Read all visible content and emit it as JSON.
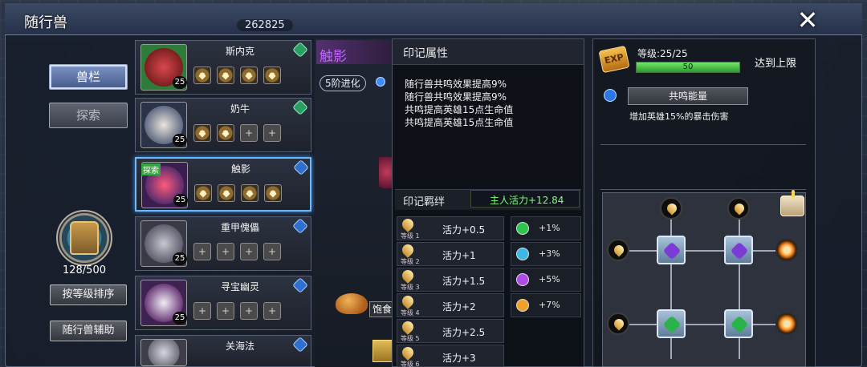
{
  "header": {
    "title": "随行兽",
    "top_value": "262825",
    "close_glyph": "✕"
  },
  "nav": {
    "tab_beast": "兽栏",
    "tab_explore": "探索"
  },
  "inventory": {
    "count": "128/500",
    "sort_button": "按等级排序",
    "assist_button": "随行兽辅助"
  },
  "pets": [
    {
      "name": "斯内克",
      "level": "25",
      "badge": "green",
      "slots": [
        "filled",
        "filled",
        "filled",
        "filled"
      ],
      "tag": "",
      "portrait_color": "#7b1f1f"
    },
    {
      "name": "奶牛",
      "level": "25",
      "badge": "green",
      "slots": [
        "filled",
        "filled",
        "empty",
        "empty"
      ],
      "tag": "",
      "portrait_color": "#3f4c6b"
    },
    {
      "name": "触影",
      "level": "25",
      "badge": "blue",
      "slots": [
        "filled",
        "filled",
        "filled",
        "filled"
      ],
      "tag": "探索",
      "portrait_color": "#5a2c6e"
    },
    {
      "name": "重甲傀儡",
      "level": "25",
      "badge": "blue",
      "slots": [
        "empty",
        "empty",
        "empty",
        "empty"
      ],
      "tag": "",
      "portrait_color": "#5e5e6d"
    },
    {
      "name": "寻宝幽灵",
      "level": "25",
      "badge": "blue",
      "slots": [
        "empty",
        "empty",
        "empty",
        "empty"
      ],
      "tag": "",
      "portrait_color": "#6b3a79"
    },
    {
      "name": "关海法",
      "level": "",
      "badge": "blue",
      "slots": [],
      "tag": "",
      "portrait_color": "#6e6e7a"
    }
  ],
  "detail": {
    "pet_title": "触影",
    "evolution_badge": "5阶进化",
    "food_button": "饱食"
  },
  "mark": {
    "title": "印记属性",
    "lines": [
      "随行兽共鸣效果提高9%",
      "随行兽共鸣效果提高9%",
      "共鸣提高英雄15点生命值",
      "共鸣提高英雄15点生命值"
    ],
    "bond_title": "印记羁绊",
    "bond_value": "主人活力+12.84",
    "bond_rows": [
      {
        "level": "等级 1",
        "text": "活力+0.5"
      },
      {
        "level": "等级 2",
        "text": "活力+1"
      },
      {
        "level": "等级 3",
        "text": "活力+1.5"
      },
      {
        "level": "等级 4",
        "text": "活力+2"
      },
      {
        "level": "等级 5",
        "text": "活力+2.5"
      },
      {
        "level": "等级 6",
        "text": "活力+3"
      }
    ],
    "gem_rows": [
      {
        "color": "#2fc44d",
        "text": "+1%"
      },
      {
        "color": "#3bb8e6",
        "text": "+3%"
      },
      {
        "color": "#b14be7",
        "text": "+5%"
      },
      {
        "color": "#f0a02a",
        "text": "+7%"
      }
    ]
  },
  "right": {
    "exp_icon": "EXP",
    "level": "等级:25/25",
    "exp_value": "50",
    "exp_fill_percent": 100,
    "max_label": "达到上限",
    "resonance_button": "共鸣能量",
    "resonance_desc": "增加英雄15%的暴击伤害"
  }
}
